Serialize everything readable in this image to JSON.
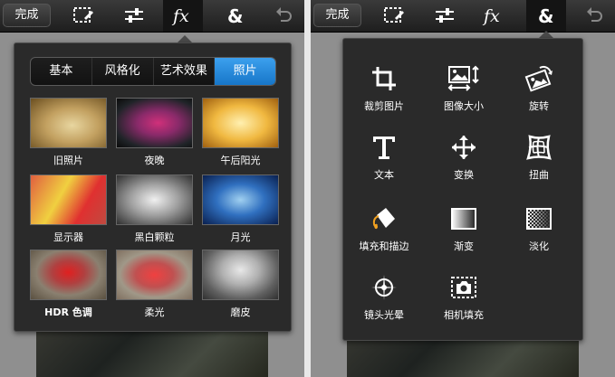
{
  "left_screen": {
    "toolbar": {
      "done_label": "完成",
      "active_tool": "fx"
    },
    "tabs": [
      {
        "label": "基本",
        "active": false
      },
      {
        "label": "风格化",
        "active": false
      },
      {
        "label": "艺术效果",
        "active": false
      },
      {
        "label": "照片",
        "active": true
      }
    ],
    "effects": [
      {
        "label": "旧照片"
      },
      {
        "label": "夜晚"
      },
      {
        "label": "午后阳光"
      },
      {
        "label": "显示器"
      },
      {
        "label": "黑白颗粒"
      },
      {
        "label": "月光"
      },
      {
        "label": "HDR 色调"
      },
      {
        "label": "柔光"
      },
      {
        "label": "磨皮"
      }
    ]
  },
  "right_screen": {
    "toolbar": {
      "done_label": "完成",
      "active_tool": "&"
    },
    "tools": [
      {
        "label": "裁剪图片",
        "icon": "crop-icon"
      },
      {
        "label": "图像大小",
        "icon": "image-size-icon"
      },
      {
        "label": "旋转",
        "icon": "rotate-icon"
      },
      {
        "label": "文本",
        "icon": "text-icon"
      },
      {
        "label": "变换",
        "icon": "move-icon"
      },
      {
        "label": "扭曲",
        "icon": "distort-icon"
      },
      {
        "label": "填充和描边",
        "icon": "fill-bucket-icon"
      },
      {
        "label": "渐变",
        "icon": "gradient-icon"
      },
      {
        "label": "淡化",
        "icon": "fade-icon"
      },
      {
        "label": "镜头光晕",
        "icon": "lens-flare-icon"
      },
      {
        "label": "相机填充",
        "icon": "camera-fill-icon"
      }
    ]
  },
  "colors": {
    "accent": "#2a8be0",
    "panel": "#2a2a2a",
    "toolbar": "#2a2a2a"
  }
}
